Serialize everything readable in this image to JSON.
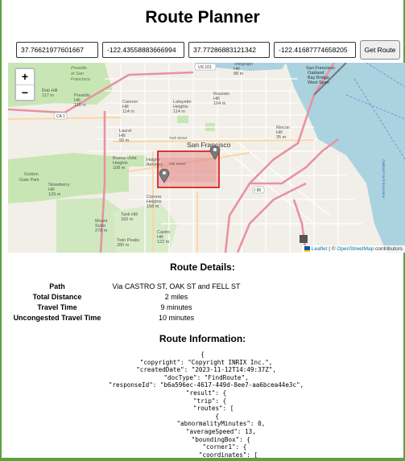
{
  "app": {
    "title": "Route Planner"
  },
  "inputs": {
    "start_lat": "37.76621977601667",
    "start_lng": "-122.43558883666994",
    "end_lat": "37.77286883121342",
    "end_lng": "-122.41687774658205",
    "button_label": "Get Route"
  },
  "map": {
    "zoom_in": "+",
    "zoom_out": "−",
    "attribution_leaflet": "Leaflet",
    "attribution_sep": " | © ",
    "attribution_osm": "OpenStreetMap",
    "attribution_rest": " contributors",
    "labels": {
      "presidio": "Presidio of San Francisco",
      "rob_hill": "Rob Hill 117 m",
      "presidio_hill": "Presidio Hill 118 m",
      "cannon_hill": "Cannon Hill 114 m",
      "lafayette": "Lafayette Heights 114 m",
      "russian_hill": "Russian Hill 104 m",
      "telegraph": "Telegraph Hill 88 m",
      "sf": "San Francisco",
      "golden_gate": "Golden Gate Park",
      "strawberry": "Strawberry Hill 129 m",
      "laurel": "Laurel Hill 99 m",
      "buena_vista": "Buena Vista Heights 108 m",
      "haight": "Haight-Ashbury",
      "corona": "Corona Heights 158 m",
      "tank_hill": "Tank Hill 182 m",
      "mount_sutro": "Mount Sutro 278 m",
      "twin_peaks": "Twin Peaks 280 m",
      "castro_hill": "Castro Hill 122 m",
      "bay_bridge": "San Francisco-Oakland Bay Bridge West Span",
      "rincon": "Rincon Hill 35 m",
      "oakland_yard": "Oakland Yard Extension",
      "us101": "US 101",
      "ca1": "CA 1",
      "i80": "I 80",
      "turk_st": "Turk Street",
      "fell_st": "Fell Street",
      "embarcadero": "Embarcadero",
      "i280": "I 280"
    }
  },
  "details": {
    "title": "Route Details:",
    "rows": [
      {
        "label": "Path",
        "value": "Via CASTRO ST, OAK ST and FELL ST"
      },
      {
        "label": "Total Distance",
        "value": "2 miles"
      },
      {
        "label": "Travel Time",
        "value": "9 minutes"
      },
      {
        "label": "Uncongested Travel Time",
        "value": "10 minutes"
      }
    ]
  },
  "info": {
    "title": "Route Information:",
    "json_text": "{\n  \"copyright\": \"Copyright INRIX Inc.\",\n  \"createdDate\": \"2023-11-12T14:49:37Z\",\n  \"docType\": \"FindRoute\",\n  \"responseId\": \"b6a596ec-4617-449d-8ee7-aa6bcea44e3c\",\n  \"result\": {\n    \"trip\": {\n      \"routes\": [\n        {\n          \"abnormalityMinutes\": 0,\n          \"averageSpeed\": 13,\n          \"boundingBox\": {\n            \"corner1\": {\n              \"coordinates\": [\n                ["
  },
  "colors": {
    "park": "#c8e6b4",
    "water": "#aad3df",
    "highway": "#e892a2",
    "primary": "#fcd6a4",
    "route_box": "#d40000",
    "pin": "#7a7a7a"
  }
}
